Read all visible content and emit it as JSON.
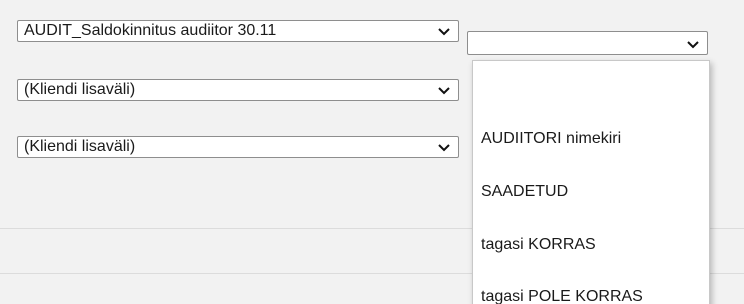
{
  "filters": {
    "report_select": {
      "value": "AUDIT_Saldokinnitus audiitor 30.11"
    },
    "status_select": {
      "value": ""
    },
    "client_field_1": {
      "value": "(Kliendi lisaväli)"
    },
    "client_field_2": {
      "value": "(Kliendi lisaväli)"
    }
  },
  "status_dropdown": {
    "options": [
      "",
      "AUDIITORI nimekiri",
      "SAADETUD",
      "tagasi KORRAS",
      "tagasi POLE KORRAS"
    ]
  },
  "icons": {
    "chevron": "chevron-down-icon"
  }
}
